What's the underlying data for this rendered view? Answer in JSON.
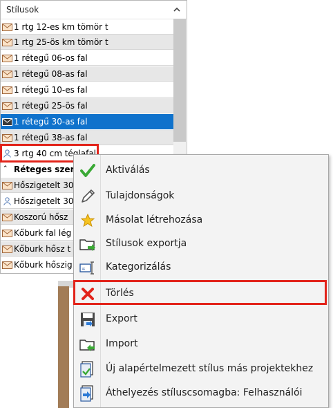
{
  "panel": {
    "title": "Stílusok",
    "items": [
      {
        "label": "1 rtg 12-es km tömör t"
      },
      {
        "label": "1 rtg 25-ös km tömör t"
      },
      {
        "label": "1 rétegű 06-os fal"
      },
      {
        "label": "1 rétegű 08-as fal"
      },
      {
        "label": "1 rétegű 10-es fal"
      },
      {
        "label": "1 rétegű 25-ös fal"
      },
      {
        "label": "1 rétegű 30-as fal"
      },
      {
        "label": "1 rétegű 38-as fal"
      },
      {
        "label": "3 rtg 40 cm téglafal"
      }
    ],
    "group_label": "Réteges szer",
    "group_items": [
      {
        "label": "Hőszigetelt 30"
      },
      {
        "label": "Hőszigetelt 30"
      },
      {
        "label": "Koszorú hősz"
      },
      {
        "label": "Kőburk fal lég"
      },
      {
        "label": "Kőburk hősz t"
      },
      {
        "label": "Kőburk hőszig"
      }
    ]
  },
  "menu": {
    "items": [
      {
        "label": "Aktiválás",
        "icon": "checkmark-icon"
      },
      {
        "label": "Tulajdonságok",
        "icon": "pencil-icon"
      },
      {
        "label": "Másolat létrehozása",
        "icon": "star-icon"
      },
      {
        "label": "Stílusok exportja",
        "icon": "folder-export-icon"
      },
      {
        "label": "Kategorizálás",
        "icon": "categorize-icon"
      },
      {
        "label": "Törlés",
        "icon": "delete-x-icon"
      },
      {
        "label": "Export",
        "icon": "export-disk-icon"
      },
      {
        "label": "Import",
        "icon": "import-folder-icon"
      },
      {
        "label": "Új alapértelmezett stílus más projektekhez",
        "icon": "new-default-style-icon"
      },
      {
        "label": "Áthelyezés stíluscsomagba: Felhasználói",
        "icon": "move-package-icon"
      }
    ]
  },
  "colors": {
    "selection": "#0f72cc",
    "highlight_border": "#e2231a",
    "wall_shape": "#a27c57"
  }
}
